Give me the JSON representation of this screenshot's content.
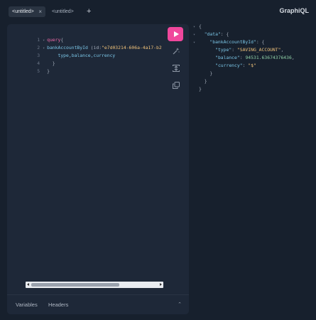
{
  "tabs": [
    {
      "label": "<untitled>",
      "active": true
    },
    {
      "label": "<untitled>",
      "active": false
    }
  ],
  "add_tab_symbol": "+",
  "brand": "GraphiQL",
  "editor": {
    "line_numbers": [
      "1",
      "2",
      "3",
      "4",
      "5"
    ],
    "line1": {
      "keyword": "query",
      "brace": "{"
    },
    "line2": {
      "field": "bankAccountById",
      "args": " (id:",
      "arg_value": "\"e7d03214-606a-4a17-b2"
    },
    "line3": {
      "fields": "type,balance,currency"
    },
    "line4": {
      "brace": "}"
    },
    "line5": {
      "brace": "}"
    }
  },
  "bottom_tabs": {
    "variables": "Variables",
    "headers": "Headers"
  },
  "result": {
    "open_brace": "{",
    "data_key": "\"data\"",
    "account_key": "\"bankAccountById\"",
    "type_key": "\"type\"",
    "type_value": "\"SAVING_ACCOUNT\"",
    "balance_key": "\"balance\"",
    "balance_value": "94531.63674376436",
    "currency_key": "\"currency\"",
    "currency_value": "\"$\"",
    "close_brace": "}"
  },
  "colors": {
    "accent": "#f0479c",
    "background": "#17202d",
    "pane": "#1e2838"
  }
}
